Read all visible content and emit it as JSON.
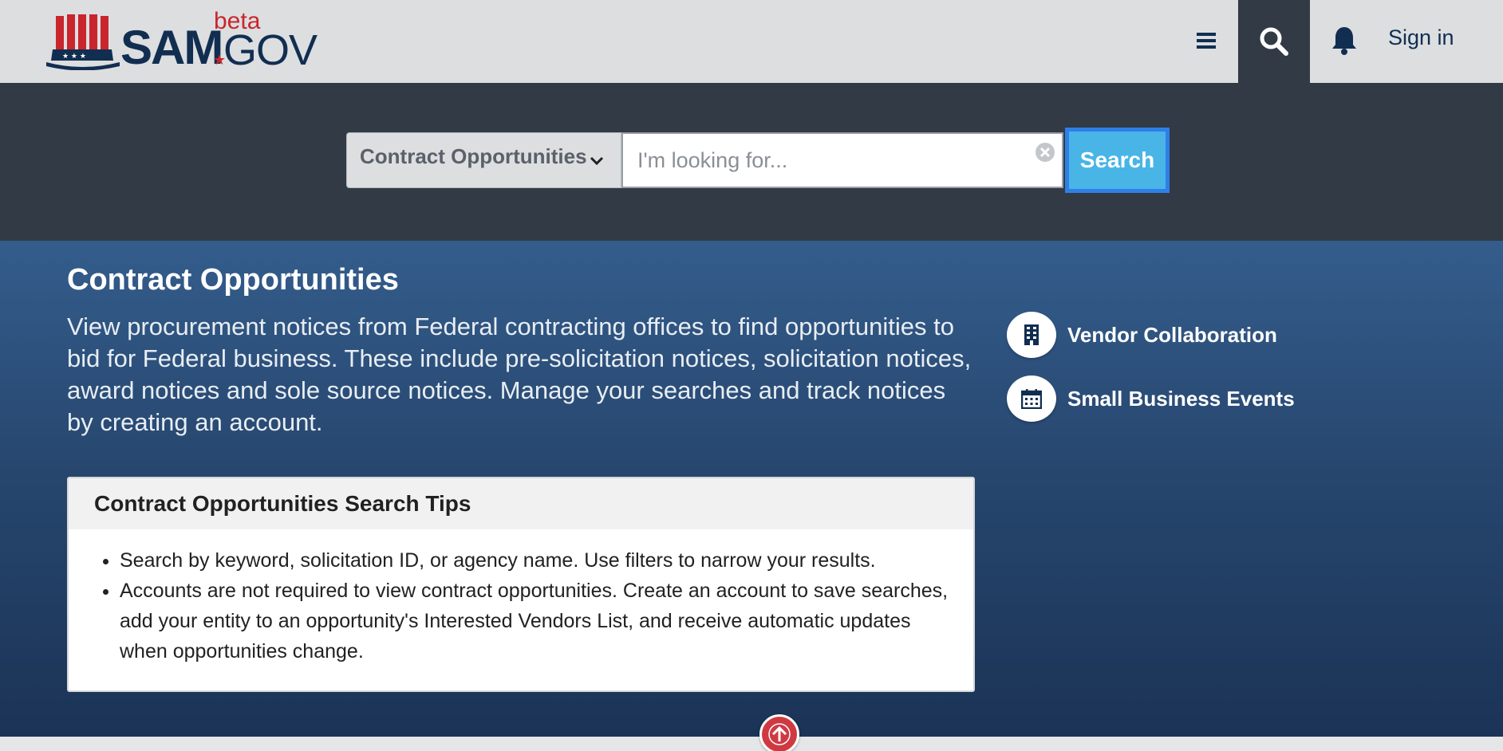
{
  "header": {
    "logo": {
      "sam": "SAM",
      "gov": "GOV",
      "beta": "beta"
    },
    "menu_icon": "hamburger-icon",
    "search_icon": "search-icon",
    "bell_icon": "bell-icon",
    "signin_label": "Sign in"
  },
  "search": {
    "domain_label": "Contract Opportunities",
    "placeholder": "I'm looking for...",
    "value": "",
    "button_label": "Search"
  },
  "main": {
    "title": "Contract Opportunities",
    "description": "View procurement notices from Federal contracting offices to find opportunities to bid for Federal business. These include pre-solicitation notices, solicitation notices, award notices and sole source notices. Manage your searches and track notices by creating an account.",
    "side_links": [
      {
        "label": "Vendor Collaboration",
        "icon": "building-icon"
      },
      {
        "label": "Small Business Events",
        "icon": "calendar-icon"
      }
    ],
    "tips": {
      "title": "Contract Opportunities Search Tips",
      "items": [
        "Search by keyword, solicitation ID, or agency name. Use filters to narrow your results.",
        "Accounts are not required to view contract opportunities. Create an account to save searches, add your entity to an opportunity's Interested Vendors List, and receive automatic updates when opportunities change."
      ]
    }
  },
  "colors": {
    "header_bg": "#dcdee0",
    "search_band_bg": "#323a45",
    "main_gradient_top": "#345d8c",
    "main_gradient_bottom": "#1b3356",
    "search_button_bg": "#48b5e6",
    "brand_navy": "#112e51",
    "brand_red": "#c9252c"
  }
}
